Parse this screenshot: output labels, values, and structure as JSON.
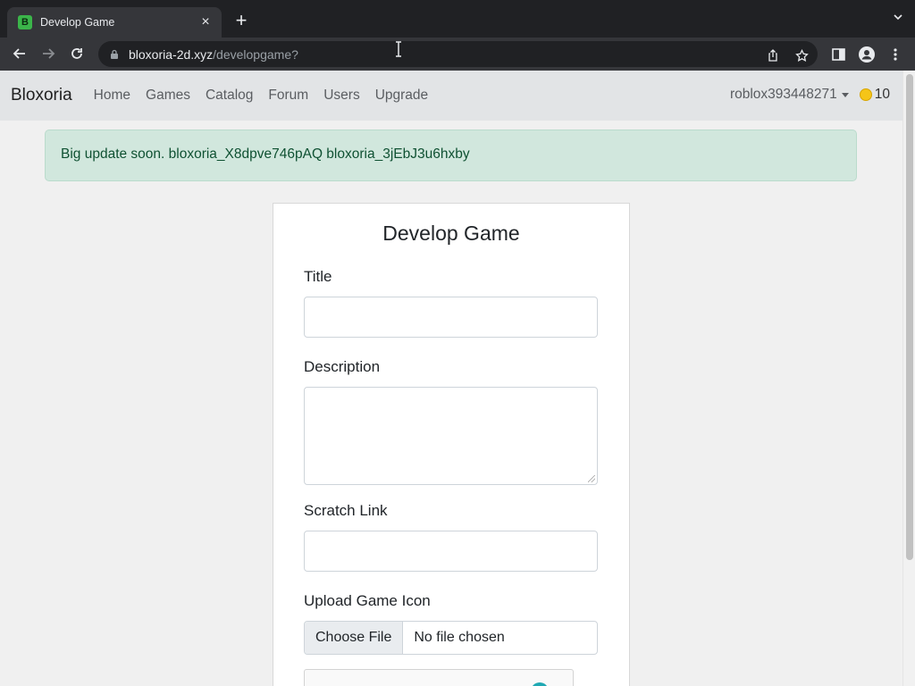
{
  "browser": {
    "tab_title": "Develop Game",
    "tab_favicon_letter": "B",
    "url_host": "bloxoria-2d.xyz",
    "url_path": "/developgame?"
  },
  "navbar": {
    "brand": "Bloxoria",
    "links": [
      "Home",
      "Games",
      "Catalog",
      "Forum",
      "Users",
      "Upgrade"
    ],
    "username": "roblox393448271",
    "coins": "10"
  },
  "alert": {
    "text": "Big update soon. bloxoria_X8dpve746pAQ bloxoria_3jEbJ3u6hxby"
  },
  "form": {
    "title": "Develop Game",
    "title_label": "Title",
    "title_value": "",
    "description_label": "Description",
    "description_value": "",
    "scratch_label": "Scratch Link",
    "scratch_value": "",
    "icon_label": "Upload Game Icon",
    "choose_file_label": "Choose File",
    "file_status": "No file chosen"
  },
  "colors": {
    "alert_bg": "#d1e7dd",
    "alert_text": "#0f5132",
    "navbar_bg": "#e2e4e6",
    "coin": "#f5c518"
  },
  "icons": [
    "back-arrow-icon",
    "forward-arrow-icon",
    "reload-icon",
    "lock-icon",
    "share-icon",
    "star-icon",
    "side-panel-icon",
    "profile-icon",
    "menu-dots-icon",
    "coin-icon",
    "captcha-logo-icon"
  ]
}
